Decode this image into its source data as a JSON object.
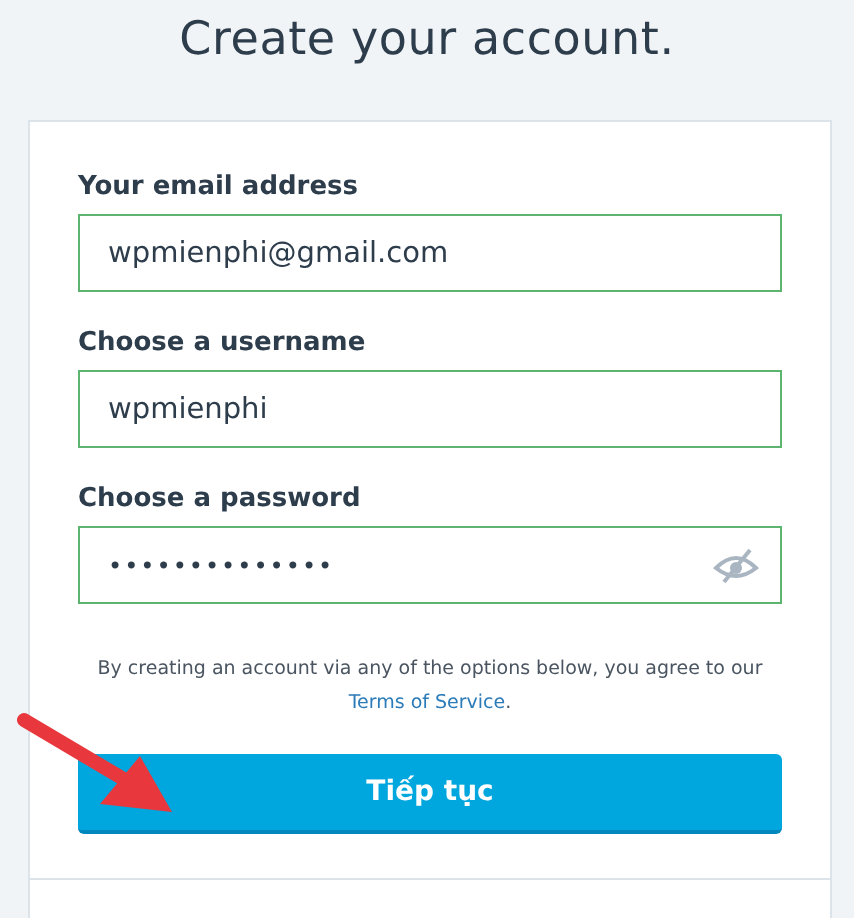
{
  "title": "Create your account.",
  "fields": [
    {
      "label": "Your email address",
      "value": "wpmienphi@gmail.com",
      "kind": "text"
    },
    {
      "label": "Choose a username",
      "value": "wpmienphi",
      "kind": "text"
    },
    {
      "label": "Choose a password",
      "value": "••••••••••••••",
      "kind": "password"
    }
  ],
  "terms": {
    "text": "By creating an account via any of the options below, you agree to our",
    "link": "Terms of Service",
    "end": "."
  },
  "submit_button": "Tiếp tục"
}
